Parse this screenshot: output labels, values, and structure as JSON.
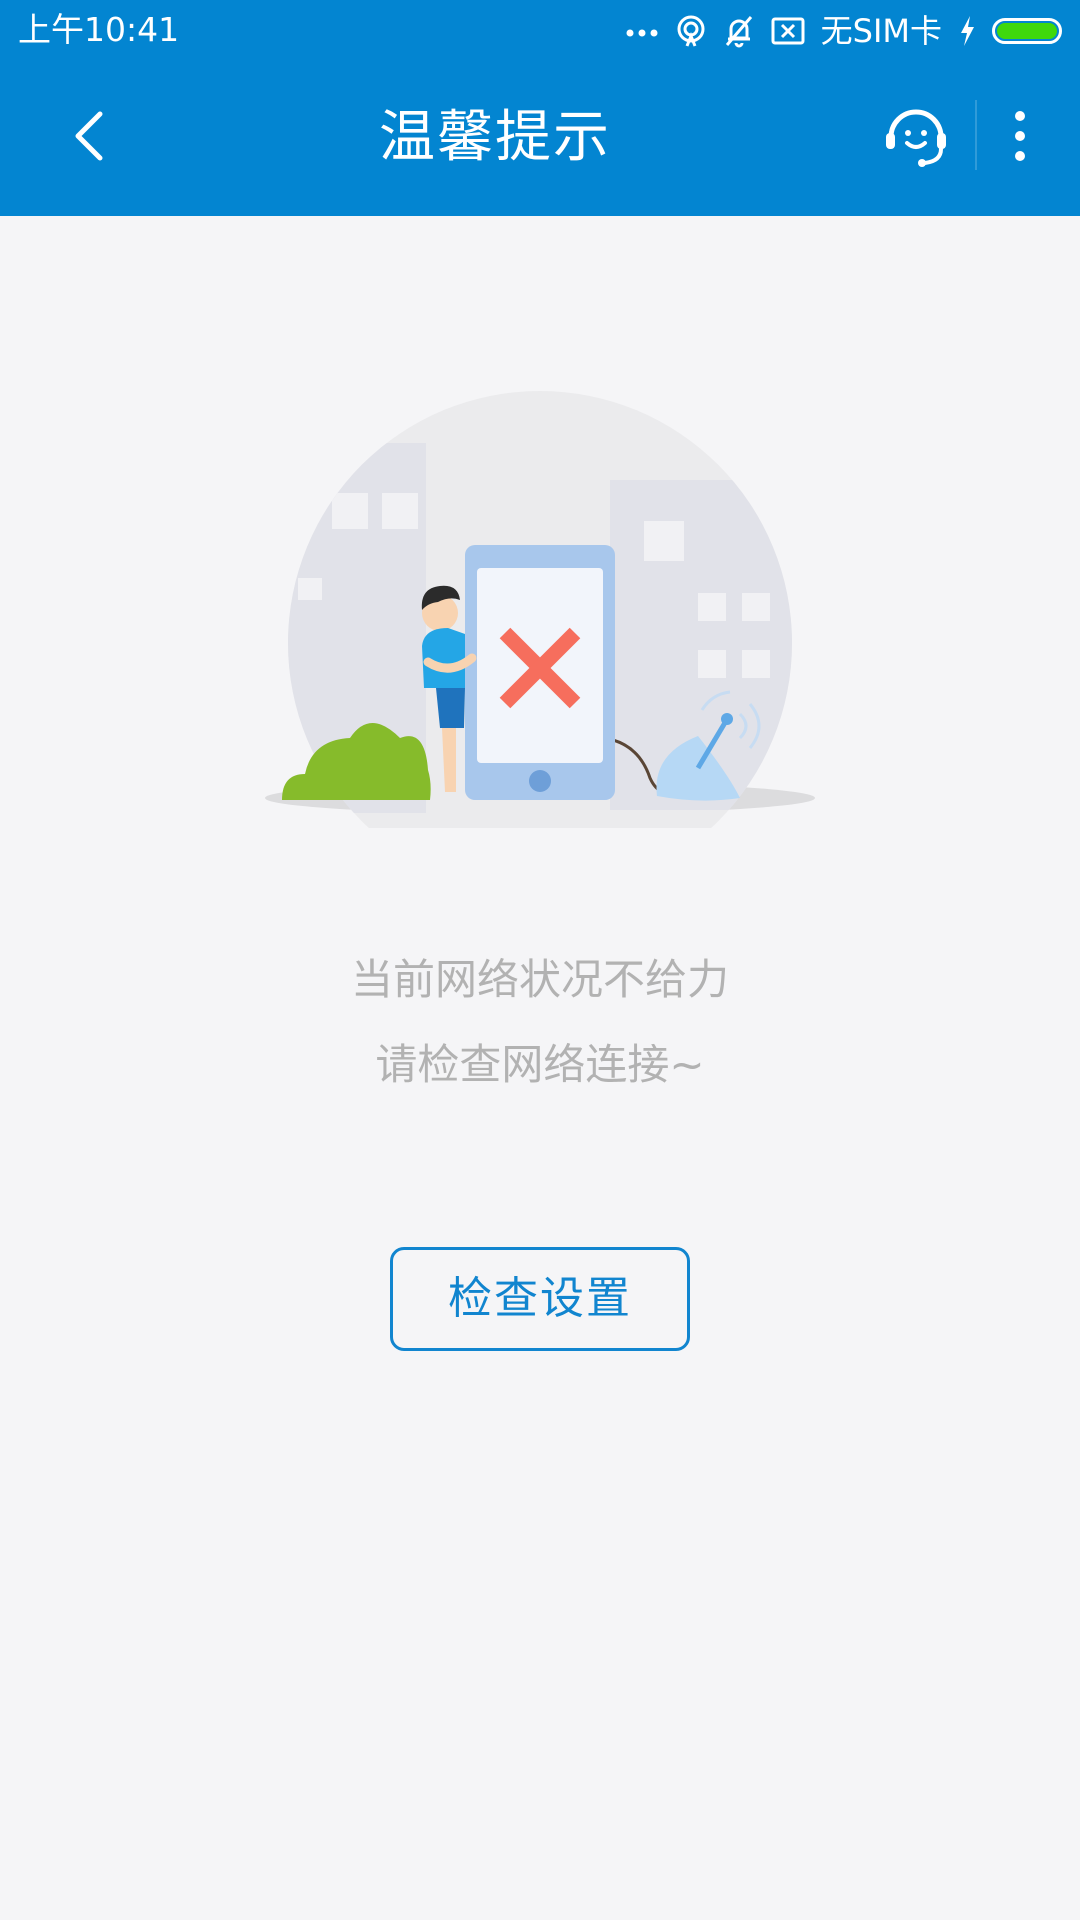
{
  "status_bar": {
    "time": "上午10:41",
    "sim_status": "无SIM卡",
    "icons": [
      "more-dots-icon",
      "hotspot-icon",
      "mute-bell-icon",
      "sim-missing-icon",
      "charging-icon",
      "battery-icon"
    ],
    "battery_color": "#3fd80c"
  },
  "app_bar": {
    "title": "温馨提示",
    "back_icon": "chevron-left-icon",
    "service_icon": "customer-service-icon",
    "more_icon": "more-vertical-icon",
    "background_color": "#0385d1"
  },
  "content": {
    "illustration": "network-error-illustration",
    "message_line1": "当前网络状况不给力",
    "message_line2": "请检查网络连接~",
    "button_label": "检查设置",
    "accent_color": "#1185cf"
  }
}
